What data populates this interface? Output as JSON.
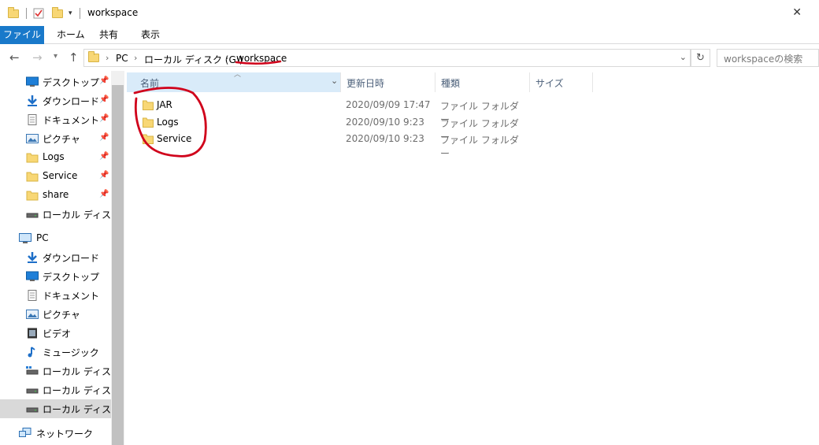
{
  "window": {
    "title": "workspace",
    "close_glyph": "✕"
  },
  "ribbon": {
    "tabs": [
      "ファイル",
      "ホーム",
      "共有",
      "表示"
    ]
  },
  "address": {
    "crumbs": [
      "PC",
      "ローカル ディスク (G:)",
      "workspace"
    ],
    "search_placeholder": "workspaceの検索"
  },
  "nav": {
    "quick_access": [
      {
        "label": "デスクトップ",
        "icon": "desktop-icon"
      },
      {
        "label": "ダウンロード",
        "icon": "download-icon"
      },
      {
        "label": "ドキュメント",
        "icon": "document-icon"
      },
      {
        "label": "ピクチャ",
        "icon": "pictures-icon"
      },
      {
        "label": "Logs",
        "icon": "folder-icon"
      },
      {
        "label": "Service",
        "icon": "folder-icon"
      },
      {
        "label": "share",
        "icon": "folder-icon"
      },
      {
        "label": "ローカル ディスク (F:)",
        "icon": "drive-icon"
      }
    ],
    "pc_label": "PC",
    "pc_items": [
      {
        "label": "ダウンロード",
        "icon": "download-icon"
      },
      {
        "label": "デスクトップ",
        "icon": "desktop-icon"
      },
      {
        "label": "ドキュメント",
        "icon": "document-icon"
      },
      {
        "label": "ピクチャ",
        "icon": "pictures-icon"
      },
      {
        "label": "ビデオ",
        "icon": "video-icon"
      },
      {
        "label": "ミュージック",
        "icon": "music-icon"
      },
      {
        "label": "ローカル ディスク (C:)",
        "icon": "drive-icon"
      },
      {
        "label": "ローカル ディスク (F:)",
        "icon": "drive-icon"
      },
      {
        "label": "ローカル ディスク (G:)",
        "icon": "drive-icon"
      }
    ],
    "network_label": "ネットワーク"
  },
  "columns": {
    "name": "名前",
    "modified": "更新日時",
    "type": "種類",
    "size": "サイズ"
  },
  "files": [
    {
      "name": "JAR",
      "modified": "2020/09/09 17:47",
      "type": "ファイル フォルダー"
    },
    {
      "name": "Logs",
      "modified": "2020/09/10 9:23",
      "type": "ファイル フォルダー"
    },
    {
      "name": "Service",
      "modified": "2020/09/10 9:23",
      "type": "ファイル フォルダー"
    }
  ],
  "colors": {
    "accent": "#1979ca",
    "annotation": "#d0021b",
    "folder": "#f8d775"
  }
}
